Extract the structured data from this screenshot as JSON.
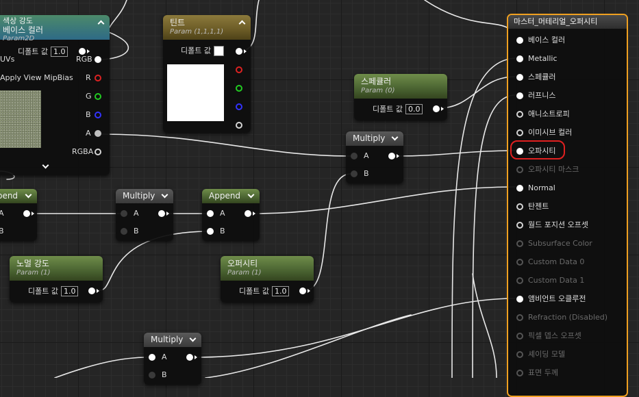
{
  "nodes": {
    "texture_sample": {
      "title_top": "색상 강도",
      "title": "베이스 컬러",
      "subtitle": "Param2D",
      "default_label": "디폴트 값",
      "default_value": "1.0",
      "pins_in": [
        "UVs",
        "Apply View MipBias"
      ],
      "pins_out": [
        "RGB",
        "R",
        "G",
        "B",
        "A",
        "RGBA"
      ]
    },
    "tint": {
      "title": "틴트",
      "subtitle": "Param (1,1,1,1)",
      "default_label": "디폴트 값",
      "swatch_color": "#ffffff"
    },
    "specular": {
      "title": "스페큘러",
      "subtitle": "Param (0)",
      "default_label": "디폴트 값",
      "default_value": "0.0"
    },
    "multiply_top": {
      "title": "Multiply",
      "pin_a": "A",
      "pin_b": "B"
    },
    "append_left": {
      "title": "Append",
      "pin_a": "A",
      "pin_b": "B"
    },
    "multiply_mid": {
      "title": "Multiply",
      "pin_a": "A",
      "pin_b": "B"
    },
    "append_mid": {
      "title": "Append",
      "pin_a": "A",
      "pin_b": "B"
    },
    "normal_intensity": {
      "title": "노멀 강도",
      "subtitle": "Param (1)",
      "default_label": "디폴트 값",
      "default_value": "1.0"
    },
    "opacity_param": {
      "title": "오퍼시티",
      "subtitle": "Param (1)",
      "default_label": "디폴트 값",
      "default_value": "1.0"
    },
    "multiply_bottom": {
      "title": "Multiply",
      "pin_a": "A",
      "pin_b": "B"
    }
  },
  "master": {
    "title": "마스터_머테리얼_오퍼시티",
    "inputs": [
      {
        "label": "베이스 컬러",
        "state": "filled"
      },
      {
        "label": "Metallic",
        "state": "filled"
      },
      {
        "label": "스페큘러",
        "state": "filled"
      },
      {
        "label": "러프니스",
        "state": "filled"
      },
      {
        "label": "애니소트로피",
        "state": "hollow"
      },
      {
        "label": "이미시브 컬러",
        "state": "hollow"
      },
      {
        "label": "오파시티",
        "state": "filled"
      },
      {
        "label": "오파시티 마스크",
        "state": "dim"
      },
      {
        "label": "Normal",
        "state": "filled"
      },
      {
        "label": "탄젠트",
        "state": "hollow"
      },
      {
        "label": "월드 포지션 오프셋",
        "state": "hollow"
      },
      {
        "label": "Subsurface Color",
        "state": "dim"
      },
      {
        "label": "Custom Data 0",
        "state": "dim"
      },
      {
        "label": "Custom Data 1",
        "state": "dim"
      },
      {
        "label": "앰비언트 오클루전",
        "state": "filled"
      },
      {
        "label": "Refraction (Disabled)",
        "state": "dim"
      },
      {
        "label": "픽셀 뎁스 오프셋",
        "state": "dim"
      },
      {
        "label": "셰이딩 모델",
        "state": "dim"
      },
      {
        "label": "표면 두께",
        "state": "dim"
      }
    ]
  },
  "colors": {
    "master_border": "#f0a020",
    "highlight": "#e02020",
    "green_header": "#4a6331",
    "gold_header": "#6b5b26"
  }
}
